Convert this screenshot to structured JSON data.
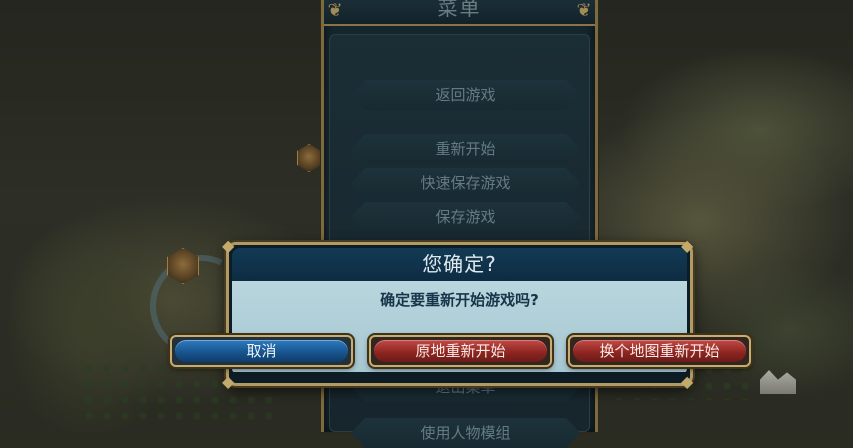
{
  "menu": {
    "title": "菜单",
    "items": [
      {
        "label": "返回游戏"
      },
      {
        "label": "重新开始"
      },
      {
        "label": "快速保存游戏"
      },
      {
        "label": "保存游戏"
      },
      {
        "label": "退出菜单"
      },
      {
        "label": "使用人物模组"
      }
    ]
  },
  "dialog": {
    "title": "您确定?",
    "message": "确定要重新开始游戏吗?",
    "buttons": {
      "cancel": "取消",
      "restart_same_map": "原地重新开始",
      "restart_new_map": "换个地图重新开始"
    }
  },
  "colors": {
    "dialog_body": "#b9d6de",
    "dialog_title_bar": "#123a55",
    "gold_border": "#b19a63",
    "cancel_button": "#18558f",
    "confirm_button": "#8f2622"
  }
}
